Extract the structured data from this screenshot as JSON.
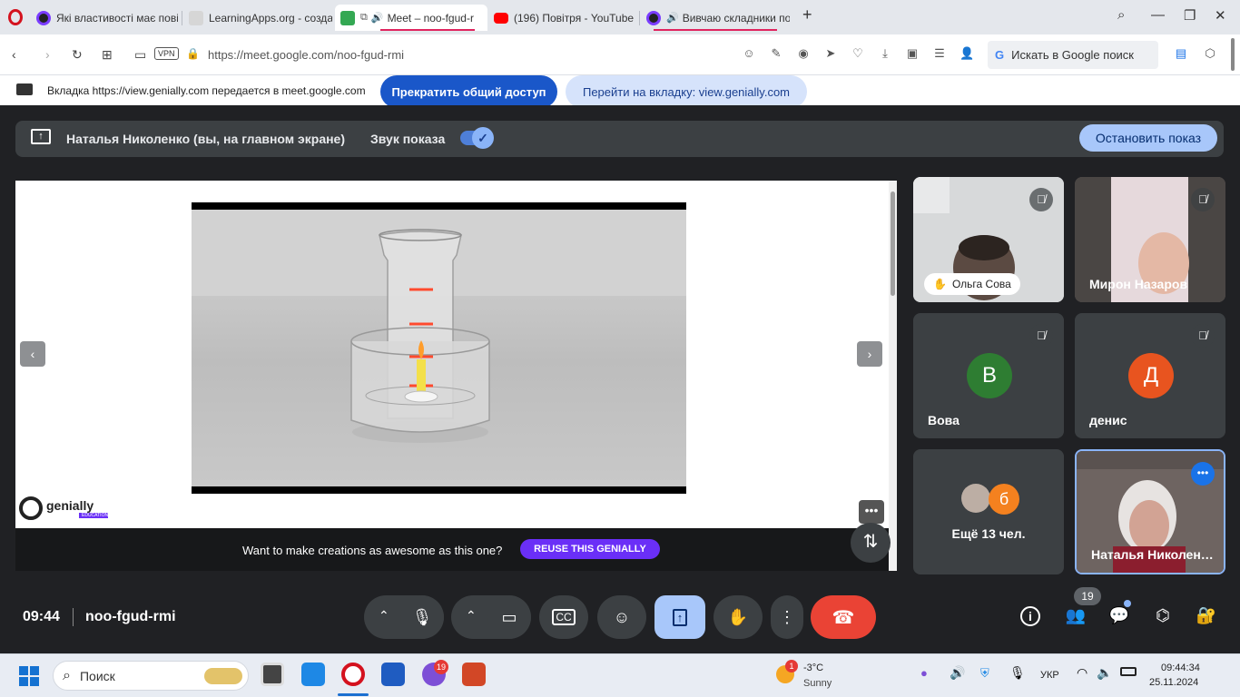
{
  "tabs": [
    {
      "title": "Які властивості має повіт"
    },
    {
      "title": "LearningApps.org - созда"
    },
    {
      "title": "Meet – noo-fgud-r"
    },
    {
      "title": "(196) Повітря - YouTube"
    },
    {
      "title": "Вивчаю складники по"
    }
  ],
  "address": {
    "url": "https://meet.google.com/noo-fgud-rmi",
    "vpn": "VPN",
    "search_label": "Искать в Google поиск"
  },
  "share_banner": {
    "text": "Вкладка https://view.genially.com передается в meet.google.com",
    "stop_label": "Прекратить общий доступ",
    "goto_label": "Перейти на вкладку: view.genially.com"
  },
  "presentation": {
    "title": "Наталья Николенко (вы, на главном экране)",
    "sound_label": "Звук показа",
    "stop_label": "Остановить показ"
  },
  "slide": {
    "logo": "genially",
    "logo_sub": "EDUCATION",
    "promo_text": "Want to make creations as awesome as this one?",
    "reuse_label": "REUSE THIS GENIALLY"
  },
  "participants": [
    {
      "name": "Ольга Сова",
      "avatar": "",
      "color": "#5a5a5a"
    },
    {
      "name": "Мирон Назаров",
      "avatar": "",
      "color": "#7b6f6a"
    },
    {
      "name": "Вова",
      "avatar": "В",
      "color": "#2e7d32"
    },
    {
      "name": "денис",
      "avatar": "Д",
      "color": "#e8541f"
    },
    {
      "name": "Ещё 13 чел.",
      "avatar": "б",
      "color": "#f4811f"
    },
    {
      "name": "Наталья Николен…",
      "avatar": "",
      "color": "#8a7f7a"
    }
  ],
  "bottom": {
    "time": "09:44",
    "code": "noo-fgud-rmi",
    "people_count": "19"
  },
  "taskbar": {
    "search": "Поиск",
    "weather_temp": "-3°C",
    "weather_desc": "Sunny",
    "weather_badge": "1",
    "viber_badge": "19",
    "lang": "УКР",
    "time": "09:44:34",
    "date": "25.11.2024"
  }
}
